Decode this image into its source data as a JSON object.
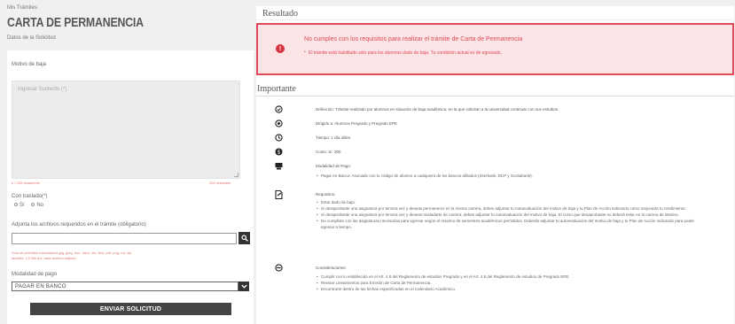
{
  "breadcrumb": "Mis Trámites",
  "page_title": "CARTA DE PERMANENCIA",
  "subtitle": "Datos de la Solicitud",
  "form": {
    "motivo_label": "Motivo de baja",
    "motivo_placeholder": "Ingresar Sustento (*)",
    "counter_left": "0 / 255 caracteres",
    "counter_right": "255 restantes",
    "traslado_label": "Con traslado(*)",
    "opt_si": "Sí",
    "opt_no": "No",
    "attach_label": "Adjunta los archivos requeridos en el trámite (obligatorio)",
    "attach_note_1": "Solo se permiten extensiones jpg, jpeg, doc, docx, xls, xlsx, pdf, png, rar, zip",
    "attach_note_2": "tamaño: 1,0 Mb por cada archivo adjunto",
    "payment_label": "Modalidad de pago",
    "payment_value": "PAGAR EN BANCO",
    "submit": "ENVIAR SOLICITUD"
  },
  "result": {
    "title": "Resultado",
    "alert_title": "No cumples con los requisitos para realizar el trámite de Carta de Permanencia",
    "alert_item": "El trámite está habilitado solo para los alumnos dado de baja. Tu condición actual es de egresado."
  },
  "important": {
    "title": "Importante",
    "definicion": "Definición: Trámite realizado por alumnos en situación de baja académica, en la que solicitan a la universidad continuar con sus estudios.",
    "dirigido": "Dirigido a: Alumnos Pregrado y Pregrado EPE",
    "tiempo": "Tiempo: 1 día útiles",
    "costo": "Costo: S/. 300",
    "modalidad": "Modalidad de Pago:",
    "modalidad_item": "Pagar en Banco: Asociado con tu código de alumno a cualquiera de los bancos afiliados (Interbank, BCP y Scotiabank).",
    "requisitos": "Requisitos:",
    "req_items": [
      "Estar dado de baja.",
      "Si desaprobaste una asignatura por tercera vez y deseas permanecer en la misma carrera, debes adjuntar tu Autoevaluación del motivo de baja y tu Plan de Acción indicando cómo mejorarás tu rendimiento.",
      "Si desaprobaste una asignatura por tercera vez y deseas trasladarte de carrera, debes adjuntar tu Autoevaluación del motivo de baja. El curso que desaprobaste no deberá estar en la carrera de destino.",
      "No cumpliste con las asignaturas necesarias para egresar según el máximo de semestres académicos permitidos. Deberás adjuntar tu autoevaluación del motivo de baja y tu Plan de Acción indicando para poder egresar a tiempo."
    ],
    "consideraciones": "Consideraciones:",
    "cons_items": [
      "Cumplir con lo establecido en el Art. 4.8 del Reglamento de estudios Pregrado y en el Art. 4.8 del Reglamento de estudios de Pregrado EPE.",
      "Revisar Lineamientos para Emisión de Carta de Permanencia.",
      "Encontrarte dentro de las fechas especificadas en el Calendario Académico."
    ]
  },
  "colors": {
    "alert_red": "#e0495a",
    "alert_bg": "#fbe4e5",
    "dark_button": "#444444"
  }
}
